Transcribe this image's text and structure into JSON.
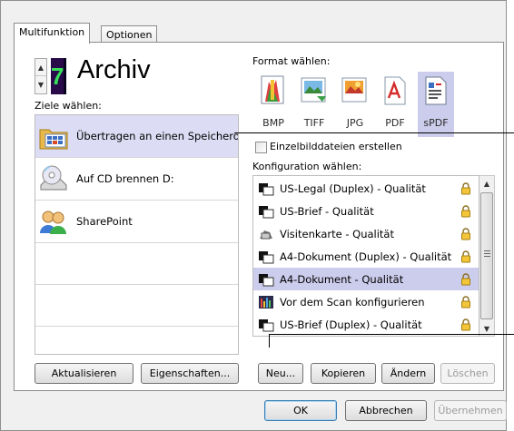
{
  "tabs": [
    {
      "label": "Multifunktion",
      "active": true
    },
    {
      "label": "Optionen",
      "active": false
    }
  ],
  "profile": {
    "number": "7",
    "title": "Archiv",
    "spinner_up": "▲",
    "spinner_down": "▼"
  },
  "destinations": {
    "label": "Ziele wählen:",
    "items": [
      {
        "label": "Übertragen an einen Speicherort",
        "icon": "folder-transfer-icon",
        "selected": true
      },
      {
        "label": "Auf CD brennen  D:",
        "icon": "cd-burn-icon",
        "selected": false
      },
      {
        "label": "SharePoint",
        "icon": "sharepoint-icon",
        "selected": false
      }
    ]
  },
  "format": {
    "label": "Format wählen:",
    "items": [
      {
        "label": "BMP",
        "icon": "bmp-icon",
        "selected": false
      },
      {
        "label": "TIFF",
        "icon": "tiff-icon",
        "selected": false
      },
      {
        "label": "JPG",
        "icon": "jpg-icon",
        "selected": false
      },
      {
        "label": "PDF",
        "icon": "pdf-icon",
        "selected": false
      },
      {
        "label": "sPDF",
        "icon": "spdf-icon",
        "selected": true
      }
    ]
  },
  "single_files": {
    "label": "Einzelbilddateien erstellen",
    "checked": false
  },
  "configurations": {
    "label": "Konfiguration wählen:",
    "items": [
      {
        "label": "US-Legal (Duplex) - Qualität",
        "icon": "scanner-icon",
        "locked": true,
        "selected": false
      },
      {
        "label": "US-Brief - Qualität",
        "icon": "scanner-icon",
        "locked": true,
        "selected": false
      },
      {
        "label": "Visitenkarte - Qualität",
        "icon": "business-card-icon",
        "locked": true,
        "selected": false
      },
      {
        "label": "A4-Dokument (Duplex) - Qualität",
        "icon": "scanner-icon",
        "locked": true,
        "selected": false
      },
      {
        "label": "A4-Dokument - Qualität",
        "icon": "scanner-icon",
        "locked": true,
        "selected": true
      },
      {
        "label": "Vor dem Scan konfigurieren",
        "icon": "configure-before-scan-icon",
        "locked": true,
        "selected": false
      },
      {
        "label": "US-Brief (Duplex) - Qualität",
        "icon": "scanner-icon",
        "locked": true,
        "selected": false
      }
    ]
  },
  "buttons": {
    "refresh": "Aktualisieren",
    "properties": "Eigenschaften...",
    "new": "Neu...",
    "copy": "Kopieren",
    "edit": "Ändern",
    "delete": "Löschen",
    "ok": "OK",
    "cancel": "Abbrechen",
    "apply": "Übernehmen"
  },
  "colors": {
    "selection": "#ccccec",
    "book_background": "#2a0b4a",
    "book_number": "#35e05a",
    "disabled_text": "#9a9a9a"
  }
}
